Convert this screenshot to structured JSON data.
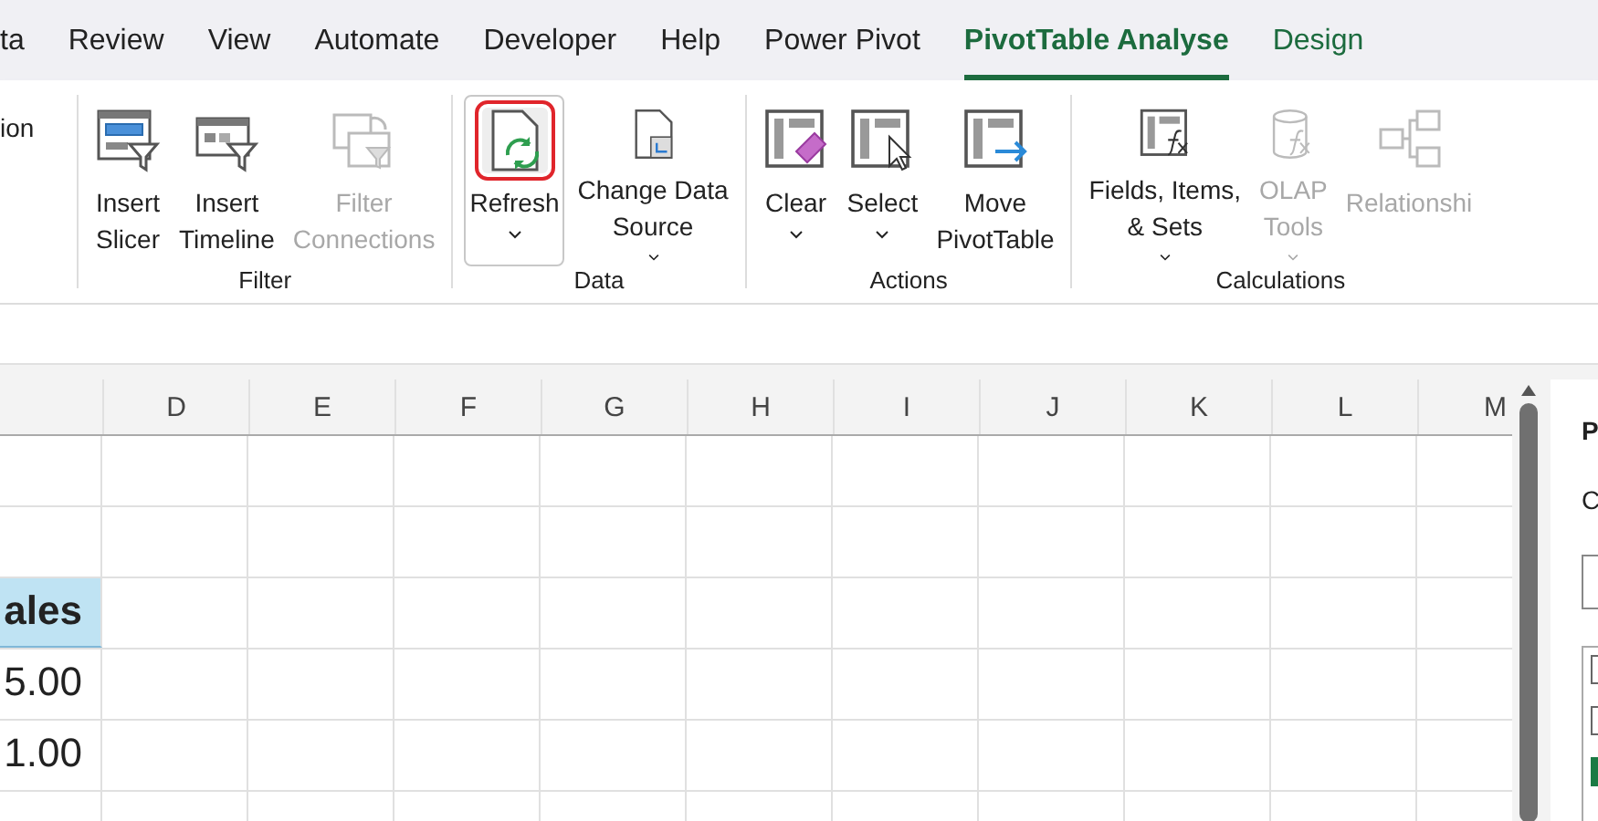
{
  "tabs": [
    {
      "label": "ta",
      "selected": false,
      "contextual": false
    },
    {
      "label": "Review",
      "selected": false,
      "contextual": false
    },
    {
      "label": "View",
      "selected": false,
      "contextual": false
    },
    {
      "label": "Automate",
      "selected": false,
      "contextual": false
    },
    {
      "label": "Developer",
      "selected": false,
      "contextual": false
    },
    {
      "label": "Help",
      "selected": false,
      "contextual": false
    },
    {
      "label": "Power Pivot",
      "selected": false,
      "contextual": false
    },
    {
      "label": "PivotTable Analyse",
      "selected": true,
      "contextual": true
    },
    {
      "label": "Design",
      "selected": false,
      "contextual": true
    }
  ],
  "ribbon": {
    "partial_group_text": "ion",
    "groups": [
      {
        "name": "Filter",
        "buttons": [
          {
            "label": "Insert\nSlicer",
            "kind": "slicer",
            "disabled": false,
            "dropdown": false,
            "highlighted": false
          },
          {
            "label": "Insert\nTimeline",
            "kind": "timeline",
            "disabled": false,
            "dropdown": false,
            "highlighted": false
          },
          {
            "label": "Filter\nConnections",
            "kind": "connections",
            "disabled": true,
            "dropdown": false,
            "highlighted": false
          }
        ]
      },
      {
        "name": "Data",
        "buttons": [
          {
            "label": "Refresh",
            "kind": "refresh",
            "disabled": false,
            "dropdown": true,
            "highlighted": true
          },
          {
            "label": "Change Data\nSource",
            "kind": "source",
            "disabled": false,
            "dropdown": true,
            "highlighted": false
          }
        ]
      },
      {
        "name": "Actions",
        "buttons": [
          {
            "label": "Clear",
            "kind": "clear",
            "disabled": false,
            "dropdown": true,
            "highlighted": false
          },
          {
            "label": "Select",
            "kind": "select",
            "disabled": false,
            "dropdown": true,
            "highlighted": false
          },
          {
            "label": "Move\nPivotTable",
            "kind": "move",
            "disabled": false,
            "dropdown": false,
            "highlighted": false
          }
        ]
      },
      {
        "name": "Calculations",
        "buttons": [
          {
            "label": "Fields, Items,\n& Sets",
            "kind": "fields",
            "disabled": false,
            "dropdown": true,
            "highlighted": false
          },
          {
            "label": "OLAP\nTools",
            "kind": "olap",
            "disabled": true,
            "dropdown": true,
            "highlighted": false
          },
          {
            "label": "Relationshi",
            "kind": "relationships",
            "disabled": true,
            "dropdown": false,
            "highlighted": false
          }
        ]
      }
    ]
  },
  "sheet": {
    "columns": [
      "D",
      "E",
      "F",
      "G",
      "H",
      "I",
      "J",
      "K",
      "L",
      "M"
    ],
    "rows": [
      {
        "kind": "empty"
      },
      {
        "kind": "empty"
      },
      {
        "kind": "header",
        "cut_column": "ales"
      },
      {
        "kind": "value",
        "cut_column": "5.00"
      },
      {
        "kind": "value",
        "cut_column": "1.00"
      },
      {
        "kind": "value"
      }
    ]
  },
  "pane": {
    "title": "P",
    "label": "C",
    "fields": [
      {
        "checked": false
      },
      {
        "checked": false
      },
      {
        "checked": true
      }
    ]
  }
}
